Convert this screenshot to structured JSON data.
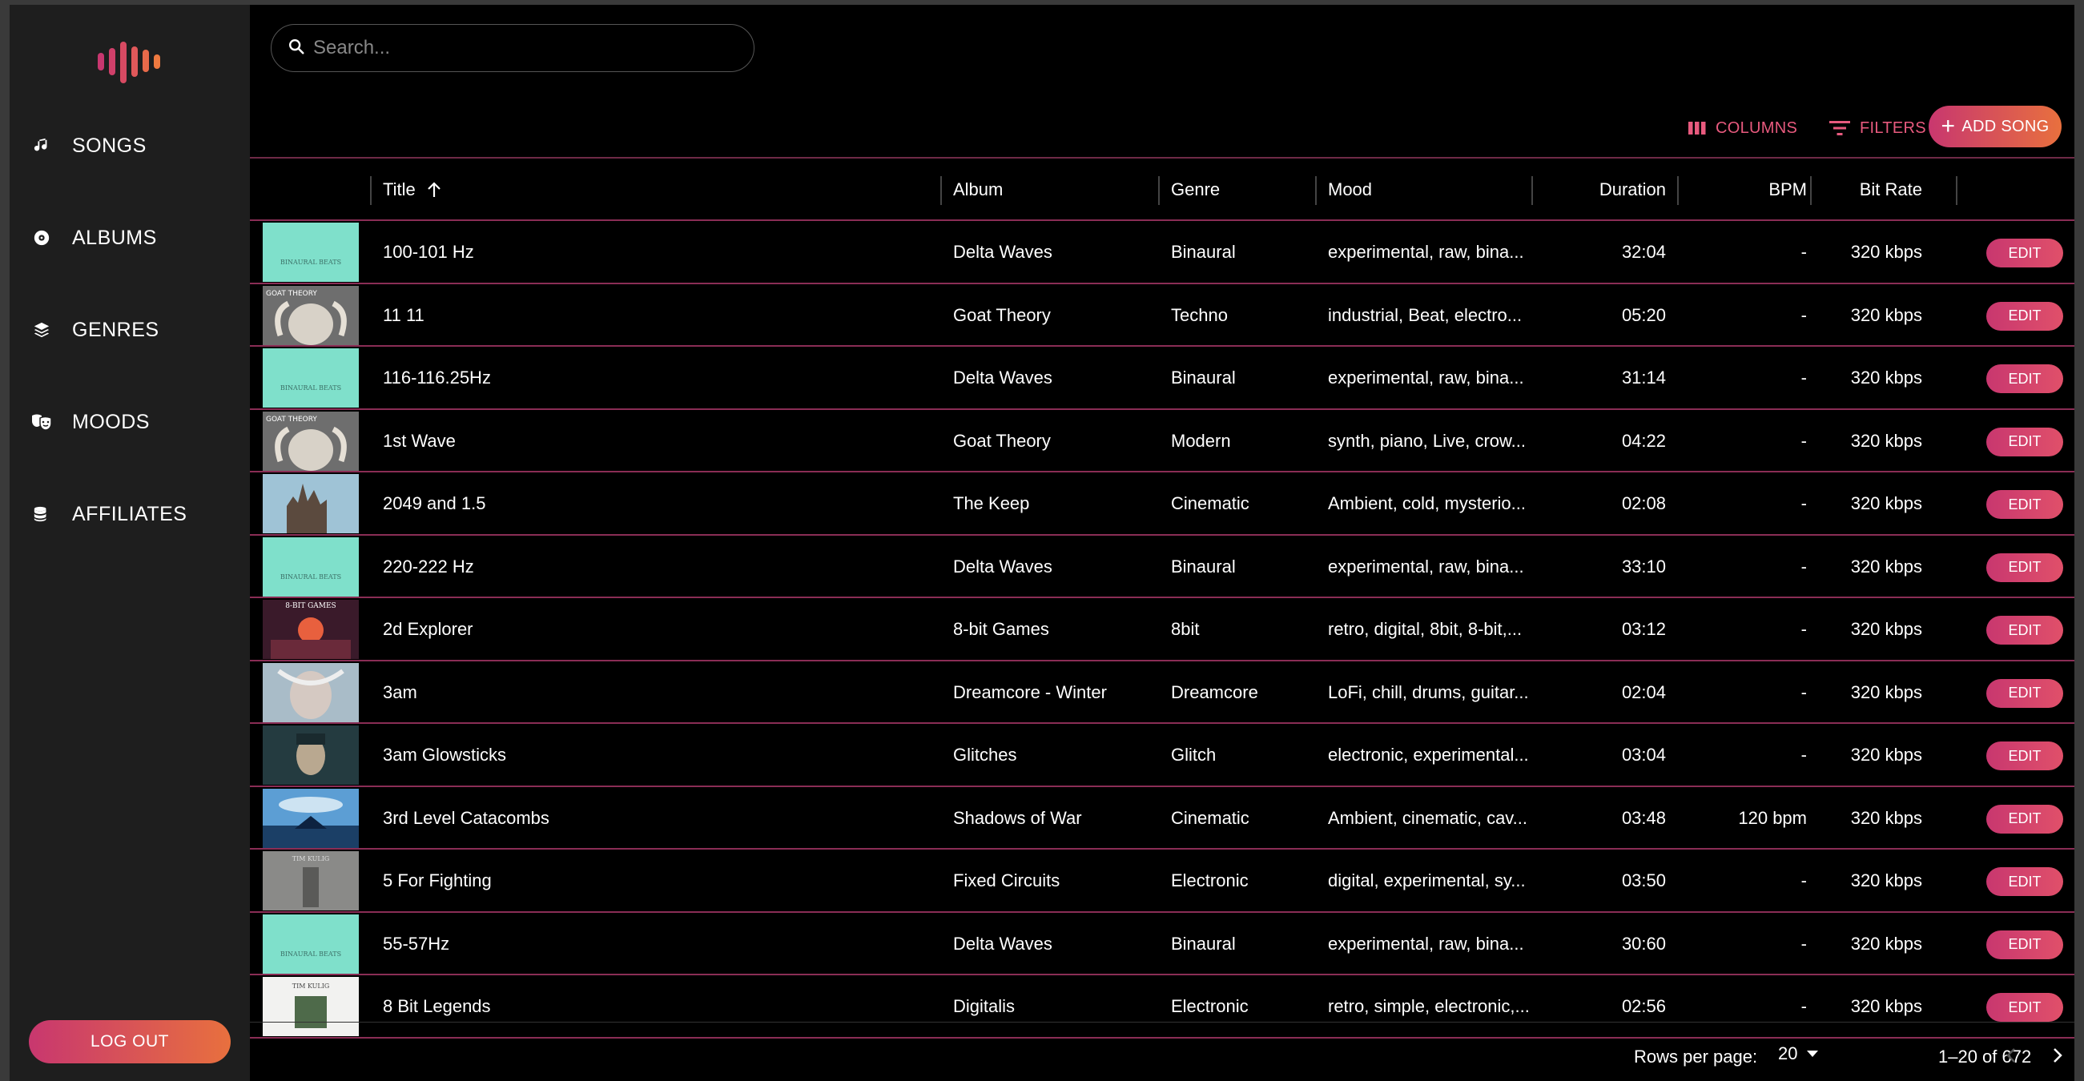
{
  "sidebar": {
    "items": [
      {
        "label": "SONGS",
        "icon": "music-note-icon"
      },
      {
        "label": "ALBUMS",
        "icon": "disc-icon"
      },
      {
        "label": "GENRES",
        "icon": "layers-icon"
      },
      {
        "label": "MOODS",
        "icon": "theater-masks-icon"
      },
      {
        "label": "AFFILIATES",
        "icon": "coins-icon"
      }
    ],
    "logout_label": "LOG OUT"
  },
  "search": {
    "placeholder": "Search..."
  },
  "toolbar": {
    "columns_label": "COLUMNS",
    "filters_label": "FILTERS",
    "add_label": "ADD SONG"
  },
  "table": {
    "headers": {
      "title": "Title",
      "album": "Album",
      "genre": "Genre",
      "mood": "Mood",
      "duration": "Duration",
      "bpm": "BPM",
      "bitrate": "Bit Rate"
    },
    "rows": [
      {
        "title": "100-101 Hz",
        "album": "Delta Waves",
        "genre": "Binaural",
        "mood": "experimental, raw, bina...",
        "duration": "32:04",
        "bpm": "-",
        "bitrate": "320 kbps",
        "art": "binaural",
        "edit": "EDIT"
      },
      {
        "title": "11 11",
        "album": "Goat Theory",
        "genre": "Techno",
        "mood": "industrial, Beat, electro...",
        "duration": "05:20",
        "bpm": "-",
        "bitrate": "320 kbps",
        "art": "goat",
        "edit": "EDIT"
      },
      {
        "title": "116-116.25Hz",
        "album": "Delta Waves",
        "genre": "Binaural",
        "mood": "experimental, raw, bina...",
        "duration": "31:14",
        "bpm": "-",
        "bitrate": "320 kbps",
        "art": "binaural",
        "edit": "EDIT"
      },
      {
        "title": "1st Wave",
        "album": "Goat Theory",
        "genre": "Modern",
        "mood": "synth, piano, Live, crow...",
        "duration": "04:22",
        "bpm": "-",
        "bitrate": "320 kbps",
        "art": "goat",
        "edit": "EDIT"
      },
      {
        "title": "2049 and 1.5",
        "album": "The Keep",
        "genre": "Cinematic",
        "mood": "Ambient, cold, mysterio...",
        "duration": "02:08",
        "bpm": "-",
        "bitrate": "320 kbps",
        "art": "keep",
        "edit": "EDIT"
      },
      {
        "title": "220-222 Hz",
        "album": "Delta Waves",
        "genre": "Binaural",
        "mood": "experimental, raw, bina...",
        "duration": "33:10",
        "bpm": "-",
        "bitrate": "320 kbps",
        "art": "binaural",
        "edit": "EDIT"
      },
      {
        "title": "2d Explorer",
        "album": "8-bit Games",
        "genre": "8bit",
        "mood": "retro, digital, 8bit, 8-bit,...",
        "duration": "03:12",
        "bpm": "-",
        "bitrate": "320 kbps",
        "art": "8bit",
        "edit": "EDIT"
      },
      {
        "title": "3am",
        "album": "Dreamcore - Winter",
        "genre": "Dreamcore",
        "mood": "LoFi, chill, drums, guitar...",
        "duration": "02:04",
        "bpm": "-",
        "bitrate": "320 kbps",
        "art": "dream",
        "edit": "EDIT"
      },
      {
        "title": "3am Glowsticks",
        "album": "Glitches",
        "genre": "Glitch",
        "mood": "electronic, experimental...",
        "duration": "03:04",
        "bpm": "-",
        "bitrate": "320 kbps",
        "art": "glitch",
        "edit": "EDIT"
      },
      {
        "title": "3rd Level Catacombs",
        "album": "Shadows of War",
        "genre": "Cinematic",
        "mood": "Ambient, cinematic, cav...",
        "duration": "03:48",
        "bpm": "120 bpm",
        "bitrate": "320 kbps",
        "art": "shadows",
        "edit": "EDIT"
      },
      {
        "title": "5 For Fighting",
        "album": "Fixed Circuits",
        "genre": "Electronic",
        "mood": "digital, experimental, sy...",
        "duration": "03:50",
        "bpm": "-",
        "bitrate": "320 kbps",
        "art": "circuits",
        "edit": "EDIT"
      },
      {
        "title": "55-57Hz",
        "album": "Delta Waves",
        "genre": "Binaural",
        "mood": "experimental, raw, bina...",
        "duration": "30:60",
        "bpm": "-",
        "bitrate": "320 kbps",
        "art": "binaural",
        "edit": "EDIT"
      },
      {
        "title": "8 Bit Legends",
        "album": "Digitalis",
        "genre": "Electronic",
        "mood": "retro, simple, electronic,...",
        "duration": "02:56",
        "bpm": "-",
        "bitrate": "320 kbps",
        "art": "digitalis",
        "edit": "EDIT"
      }
    ],
    "art_text": {
      "binaural": "BINAURAL BEATS",
      "goat": "GOAT THEORY",
      "8bit": "8-BIT GAMES",
      "circuits": "TIM KULIG",
      "digitalis": "TIM KULIG"
    }
  },
  "pagination": {
    "rows_label": "Rows per page:",
    "rows_value": "20",
    "range": "1–20 of 672"
  },
  "colors": {
    "accent": "#e85a7e",
    "gradient_start": "#c8376f",
    "gradient_end": "#e8703e",
    "row_border": "#8a2d55"
  }
}
